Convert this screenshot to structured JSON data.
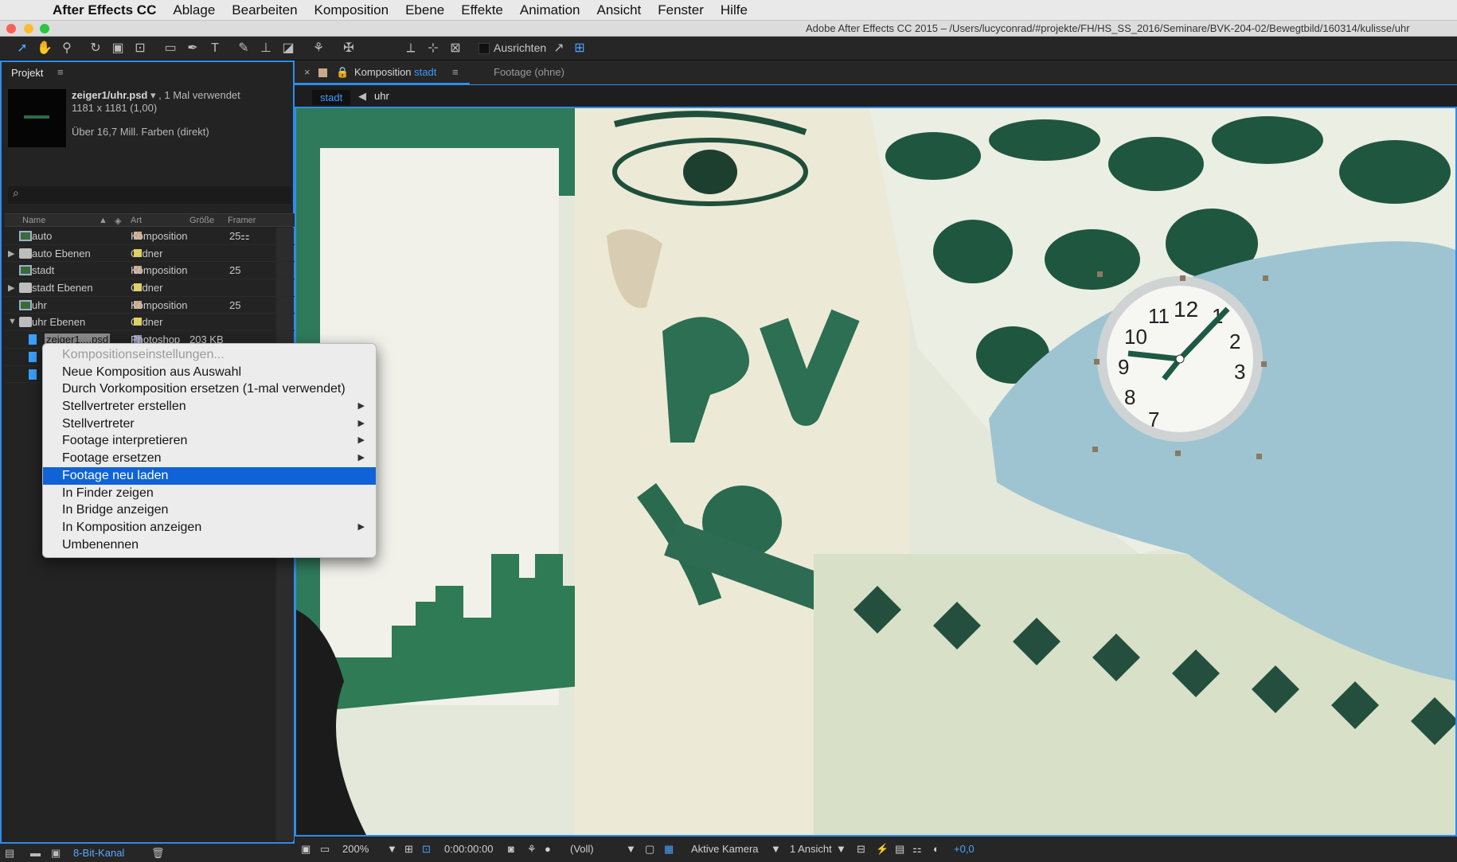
{
  "menubar": {
    "items": [
      "After Effects CC",
      "Ablage",
      "Bearbeiten",
      "Komposition",
      "Ebene",
      "Effekte",
      "Animation",
      "Ansicht",
      "Fenster",
      "Hilfe"
    ]
  },
  "titlebar": {
    "title": "Adobe After Effects CC 2015 – /Users/lucyconrad/#projekte/FH/HS_SS_2016/Seminare/BVK-204-02/Bewegtbild/160314/kulisse/uhr"
  },
  "toolbar": {
    "align_label": "Ausrichten"
  },
  "project": {
    "tab_label": "Projekt",
    "menu_glyph": "≡",
    "file_name": "zeiger1/uhr.psd",
    "usage": ", 1 Mal verwendet",
    "dimensions": "1181 x 1181 (1,00)",
    "colors": "Über 16,7 Mill. Farben (direkt)",
    "search_glyph": "⌕",
    "columns": [
      "Name",
      "Art",
      "Größe",
      "Framer"
    ],
    "items": [
      {
        "name": "auto",
        "type": "Komposition",
        "size": "",
        "rate": "25",
        "kind": "comp",
        "swatch": "#c9a98a",
        "tri": ""
      },
      {
        "name": "auto Ebenen",
        "type": "Ordner",
        "size": "",
        "rate": "",
        "kind": "folder",
        "swatch": "#e8d43a",
        "tri": "▶"
      },
      {
        "name": "stadt",
        "type": "Komposition",
        "size": "",
        "rate": "25",
        "kind": "comp",
        "swatch": "#c9a98a",
        "tri": ""
      },
      {
        "name": "stadt Ebenen",
        "type": "Ordner",
        "size": "",
        "rate": "",
        "kind": "folder",
        "swatch": "#e8d43a",
        "tri": "▶"
      },
      {
        "name": "uhr",
        "type": "Komposition",
        "size": "",
        "rate": "25",
        "kind": "comp",
        "swatch": "#c9a98a",
        "tri": ""
      },
      {
        "name": "uhr Ebenen",
        "type": "Ordner",
        "size": "",
        "rate": "",
        "kind": "folder",
        "swatch": "#e8d43a",
        "tri": "▼"
      },
      {
        "name": "zeiger1....psd",
        "type": "Photoshop",
        "size": "203 KB",
        "rate": "",
        "kind": "psd",
        "swatch": "#8f8fb8",
        "tri": ""
      }
    ],
    "footer_bit": "8-Bit-Kanal"
  },
  "comp": {
    "tab_close": "×",
    "tab_label": "Komposition",
    "tab_comp_name": "stadt",
    "tab_menu": "≡",
    "tab_footage": "Footage (ohne)",
    "breadcrumbs": [
      "stadt",
      "uhr"
    ]
  },
  "context_menu": {
    "items": [
      {
        "label": "Kompositionseinstellungen...",
        "disabled": true,
        "submenu": false,
        "highlight": false
      },
      {
        "label": "Neue Komposition aus Auswahl",
        "disabled": false,
        "submenu": false,
        "highlight": false
      },
      {
        "label": "Durch Vorkomposition ersetzen (1-mal verwendet)",
        "disabled": false,
        "submenu": false,
        "highlight": false
      },
      {
        "label": "Stellvertreter erstellen",
        "disabled": false,
        "submenu": true,
        "highlight": false
      },
      {
        "label": "Stellvertreter",
        "disabled": false,
        "submenu": true,
        "highlight": false
      },
      {
        "label": "Footage interpretieren",
        "disabled": false,
        "submenu": true,
        "highlight": false
      },
      {
        "label": "Footage ersetzen",
        "disabled": false,
        "submenu": true,
        "highlight": false
      },
      {
        "label": "Footage neu laden",
        "disabled": false,
        "submenu": false,
        "highlight": true
      },
      {
        "label": "In Finder zeigen",
        "disabled": false,
        "submenu": false,
        "highlight": false
      },
      {
        "label": "In Bridge anzeigen",
        "disabled": false,
        "submenu": false,
        "highlight": false
      },
      {
        "label": "In Komposition anzeigen",
        "disabled": false,
        "submenu": true,
        "highlight": false
      },
      {
        "label": "Umbenennen",
        "disabled": false,
        "submenu": false,
        "highlight": false
      }
    ]
  },
  "viewer_footer": {
    "zoom": "200%",
    "timecode": "0:00:00:00",
    "resolution": "(Voll)",
    "camera": "Aktive Kamera",
    "views": "1 Ansicht",
    "exposure": "+0,0"
  },
  "viewer_art": {
    "clock_numbers": [
      "12",
      "1",
      "2",
      "3",
      "7",
      "8",
      "9",
      "10",
      "11"
    ],
    "graffiti": "RV"
  }
}
